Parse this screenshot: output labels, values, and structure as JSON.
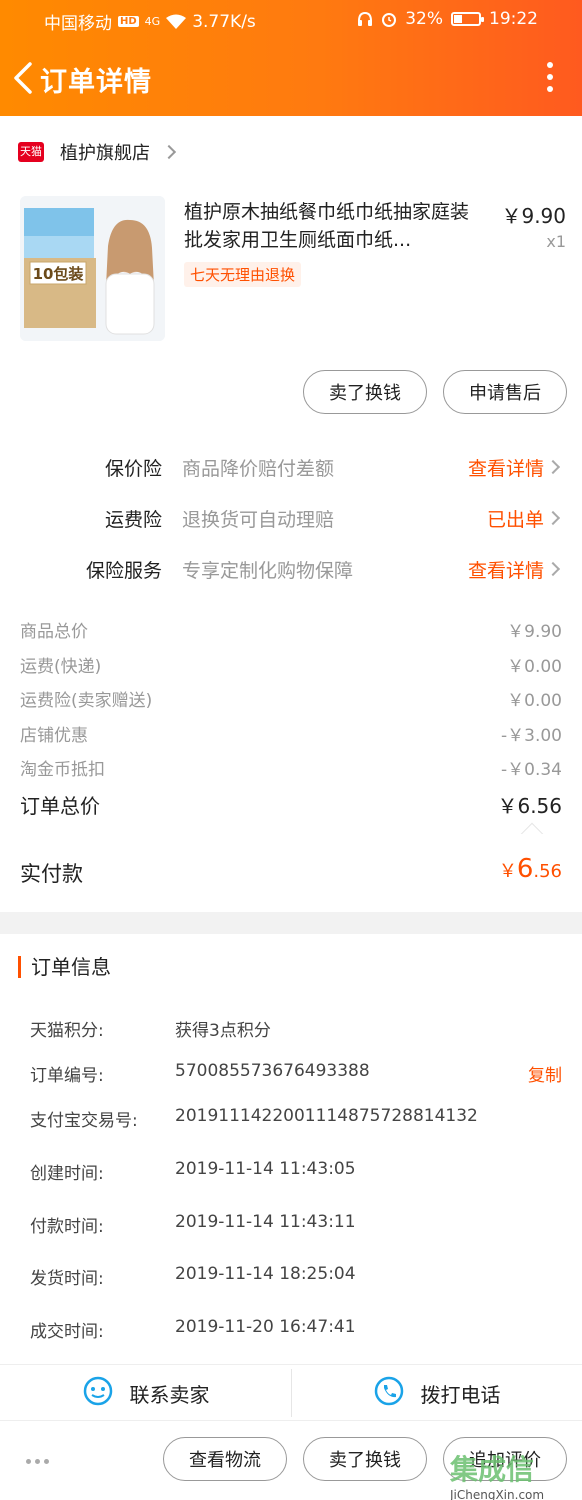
{
  "status_bar": {
    "carrier": "中国移动",
    "hd": "HD",
    "signal": "4G",
    "speed": "3.77K/s",
    "battery": "32%",
    "battery_level": 0.32,
    "time": "19:22"
  },
  "header": {
    "title": "订单详情"
  },
  "store": {
    "badge": "天猫",
    "name": "植护旗舰店"
  },
  "product": {
    "title": "植护原木抽纸餐巾纸巾纸抽家庭装批发家用卫生厕纸面巾纸...",
    "price": "￥9.90",
    "qty": "x1",
    "tag": "七天无理由退换",
    "image_text": "10包装"
  },
  "product_actions": {
    "sell": "卖了换钱",
    "after_sale": "申请售后"
  },
  "insurance": [
    {
      "label": "保价险",
      "desc": "商品降价赔付差额",
      "action": "查看详情"
    },
    {
      "label": "运费险",
      "desc": "退换货可自动理赔",
      "action": "已出单"
    },
    {
      "label": "保险服务",
      "desc": "专享定制化购物保障",
      "action": "查看详情"
    }
  ],
  "price_breakdown": [
    {
      "k": "商品总价",
      "v": "￥9.90"
    },
    {
      "k": "运费(快递)",
      "v": "￥0.00"
    },
    {
      "k": "运费险(卖家赠送)",
      "v": "￥0.00"
    },
    {
      "k": "店铺优惠",
      "v": "-￥3.00"
    },
    {
      "k": "淘金币抵扣",
      "v": "-￥0.34"
    }
  ],
  "total": {
    "k": "订单总价",
    "v": "￥6.56"
  },
  "paid": {
    "k": "实付款",
    "currency": "￥",
    "int": "6",
    "dec": ".56"
  },
  "order_info": {
    "title": "订单信息",
    "rows": [
      {
        "k": "天猫积分:",
        "v": "获得3点积分"
      },
      {
        "k": "订单编号:",
        "v": "570085573676493388",
        "action": "复制"
      },
      {
        "k": "支付宝交易号:",
        "v": "2019111422001114875728814132"
      },
      {
        "k": "创建时间:",
        "v": "2019-11-14 11:43:05"
      },
      {
        "k": "付款时间:",
        "v": "2019-11-14 11:43:11"
      },
      {
        "k": "发货时间:",
        "v": "2019-11-14 18:25:04"
      },
      {
        "k": "成交时间:",
        "v": "2019-11-20 16:47:41"
      }
    ]
  },
  "contact": {
    "seller": "联系卖家",
    "phone": "拨打电话"
  },
  "bottom_actions": {
    "logistics": "查看物流",
    "sell": "卖了换钱",
    "review": "追加评价"
  },
  "watermark": {
    "main": "集成信",
    "sub": "JiChengXin.com"
  },
  "colors": {
    "accent": "#ff5000",
    "header_start": "#ff8a00",
    "header_end": "#ff5a1f",
    "contact_icon": "#1aa3e8"
  }
}
